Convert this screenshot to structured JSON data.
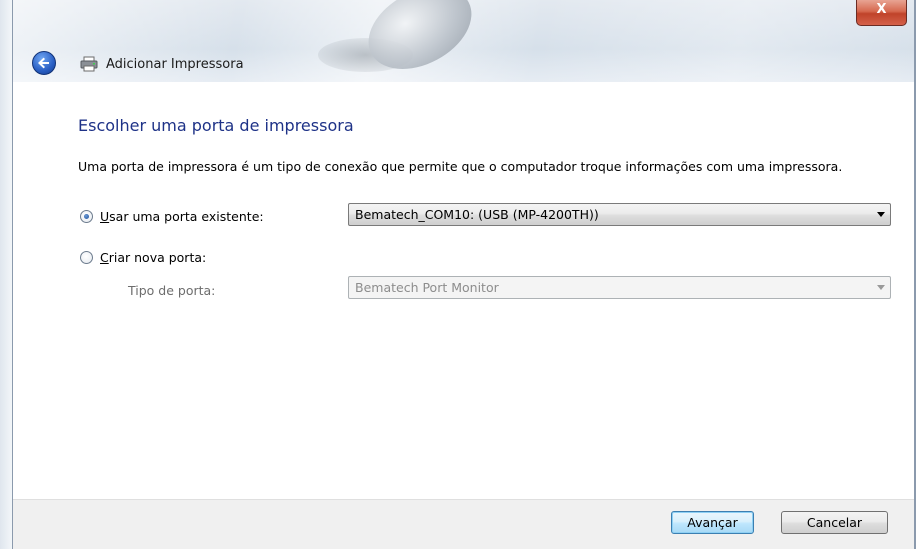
{
  "window": {
    "title": "Adicionar Impressora",
    "close_symbol": "X"
  },
  "icons": {
    "back": "back-arrow-icon",
    "printer": "printer-icon",
    "close": "close-icon",
    "dropdown": "chevron-down-icon"
  },
  "main": {
    "heading": "Escolher uma porta de impressora",
    "description": "Uma porta de impressora é um tipo de conexão que permite que o computador troque informações com uma impressora."
  },
  "options": {
    "existing_port": {
      "label_mnemonic": "U",
      "label_rest": "sar uma porta existente:",
      "selected": true,
      "value": "Bematech_COM10: (USB (MP-4200TH))"
    },
    "new_port": {
      "label_mnemonic": "C",
      "label_rest": "riar nova porta:",
      "selected": false,
      "type_label": "Tipo de porta:",
      "type_value": "Bematech Port Monitor"
    }
  },
  "footer": {
    "next_label": "Avançar",
    "cancel_label": "Cancelar"
  },
  "colors": {
    "heading": "#1e3287",
    "close_button": "#c0432a",
    "back_button": "#2a5fc4"
  }
}
